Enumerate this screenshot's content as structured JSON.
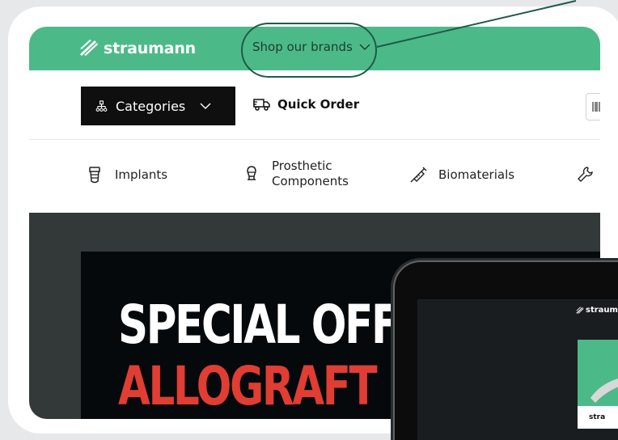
{
  "header": {
    "logo_text": "straumann",
    "brands_label": "Shop our brands"
  },
  "toolbar": {
    "categories_label": "Categories",
    "quick_order_label": "Quick Order"
  },
  "categories": {
    "items": [
      {
        "label": "Implants",
        "icon": "implant-icon"
      },
      {
        "label_line1": "Prosthetic",
        "label_line2": "Components",
        "icon": "prosthetic-icon"
      },
      {
        "label": "Biomaterials",
        "icon": "syringe-icon"
      }
    ]
  },
  "hero": {
    "line1": "SPECIAL OFFE",
    "line2": "ALLOGRAFT"
  },
  "tablet": {
    "logo_text": "straum",
    "card_logo_text": "stra"
  },
  "colors": {
    "brand_green": "#4cba88",
    "hero_bg": "#333838",
    "hero_red": "#e03d33",
    "highlight": "#1f5a4a"
  }
}
